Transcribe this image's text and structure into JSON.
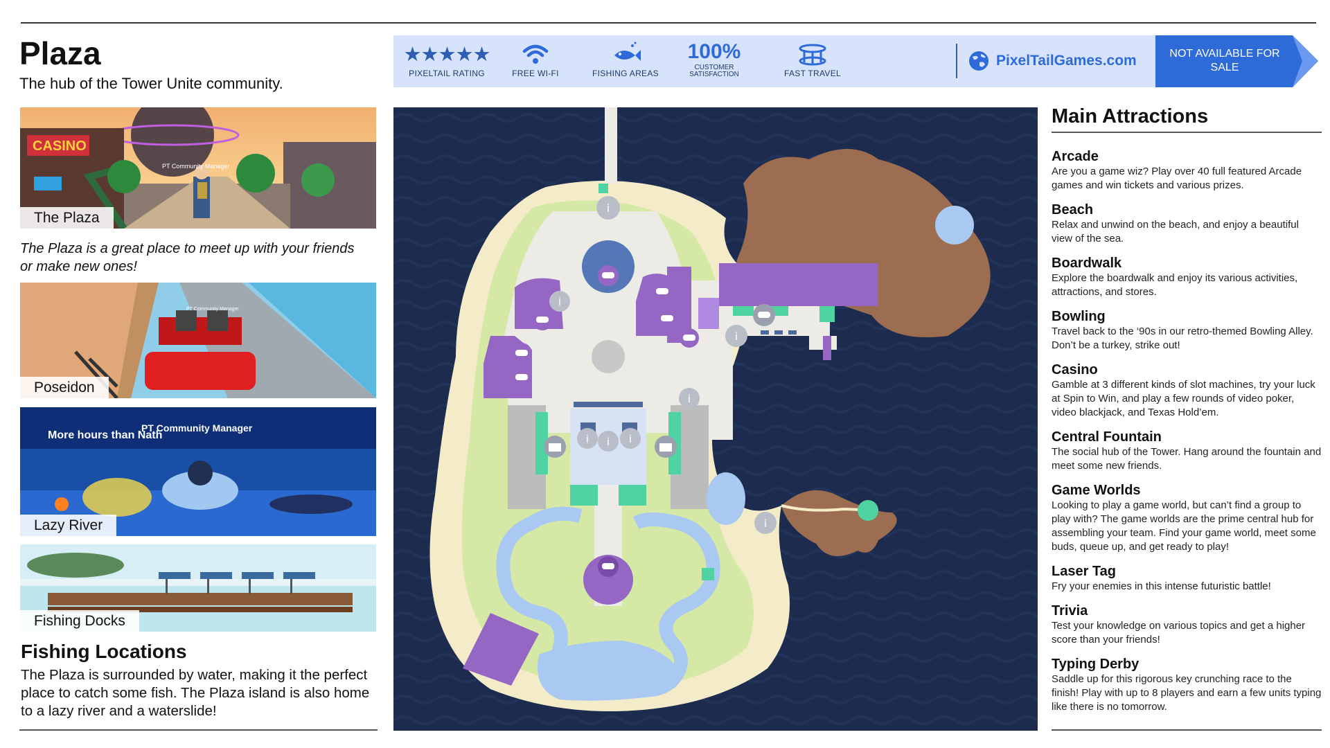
{
  "page": {
    "title": "Plaza",
    "subtitle": "The hub of the Tower Unite community."
  },
  "photos": [
    {
      "caption": "The Plaza",
      "scene": "plaza-screenshot"
    },
    {
      "caption": "Poseidon",
      "scene": "rollercoaster-screenshot"
    },
    {
      "caption": "Lazy River",
      "scene": "river-screenshot"
    },
    {
      "caption": "Fishing Docks",
      "scene": "docks-screenshot"
    }
  ],
  "quote": "The Plaza is a great place to meet up with your friends or make new ones!",
  "photo_overlays": {
    "plaza_sign": "CASINO",
    "plaza_name": "PT Community Manager",
    "poseidon_name": "PT Community Manager",
    "river_name": "PT Community Manager",
    "river_chat": "More hours than Nath"
  },
  "fishing": {
    "title": "Fishing Locations",
    "text": "The Plaza is surrounded by water, making it the perfect place to catch some fish. The Plaza island is also home to a lazy river and a waterslide!"
  },
  "banner": {
    "features": [
      {
        "label": "PIXELTAIL RATING",
        "icon": "stars-icon",
        "value": "★★★★★"
      },
      {
        "label": "FREE WI-FI",
        "icon": "wifi-icon"
      },
      {
        "label": "FISHING AREAS",
        "icon": "fish-icon"
      },
      {
        "label": "CUSTOMER SATISFACTION",
        "icon": "percent-text",
        "value": "100%"
      },
      {
        "label": "FAST TRAVEL",
        "icon": "teleporter-icon"
      }
    ],
    "website": "PixelTailGames.com",
    "website_icon": "globe-icon",
    "sale_text": "NOT AVAILABLE FOR SALE",
    "accent": "#2e6bd8",
    "banner_bg": "#d6e3fa"
  },
  "map": {
    "colors": {
      "water": "#1c2b4e",
      "sand": "#f4ecc9",
      "grass": "#d6e8a6",
      "plaza": "#ecebe6",
      "building": "#9566c4",
      "rock": "#9c6d50",
      "river": "#a9c8f2",
      "teal": "#4fd3a2",
      "gray": "#bcbcbc"
    },
    "icons": [
      "info-icon",
      "gamepad-icon",
      "shop-icon"
    ]
  },
  "attractions": {
    "title": "Main Attractions",
    "items": [
      {
        "name": "Arcade",
        "desc": "Are you a game wiz? Play over 40 full featured Arcade games and win tickets and various prizes."
      },
      {
        "name": "Beach",
        "desc": "Relax and unwind on the beach, and enjoy a beautiful view of the sea."
      },
      {
        "name": "Boardwalk",
        "desc": "Explore the boardwalk and enjoy its various activities, attractions, and stores."
      },
      {
        "name": "Bowling",
        "desc": "Travel back to the ‘90s in our retro-themed Bowling Alley. Don’t be a turkey, strike out!"
      },
      {
        "name": "Casino",
        "desc": "Gamble at 3 different kinds of slot machines, try your luck at Spin to Win, and play a few rounds of video poker, video blackjack, and Texas Hold’em."
      },
      {
        "name": "Central Fountain",
        "desc": "The social hub of the Tower. Hang around the fountain and meet some new friends."
      },
      {
        "name": "Game Worlds",
        "desc": "Looking to play a game world, but can’t find a group to play with? The game worlds are the prime central hub for assembling your team. Find your game world, meet some buds, queue up, and get ready to play!"
      },
      {
        "name": "Laser Tag",
        "desc": "Fry your enemies in this intense futuristic battle!"
      },
      {
        "name": "Trivia",
        "desc": "Test your knowledge on various topics and get a higher score than your friends!"
      },
      {
        "name": "Typing Derby",
        "desc": "Saddle up for this rigorous key crunching race to the finish! Play with up to 8 players and earn a few units typing like there is no tomorrow."
      }
    ]
  }
}
